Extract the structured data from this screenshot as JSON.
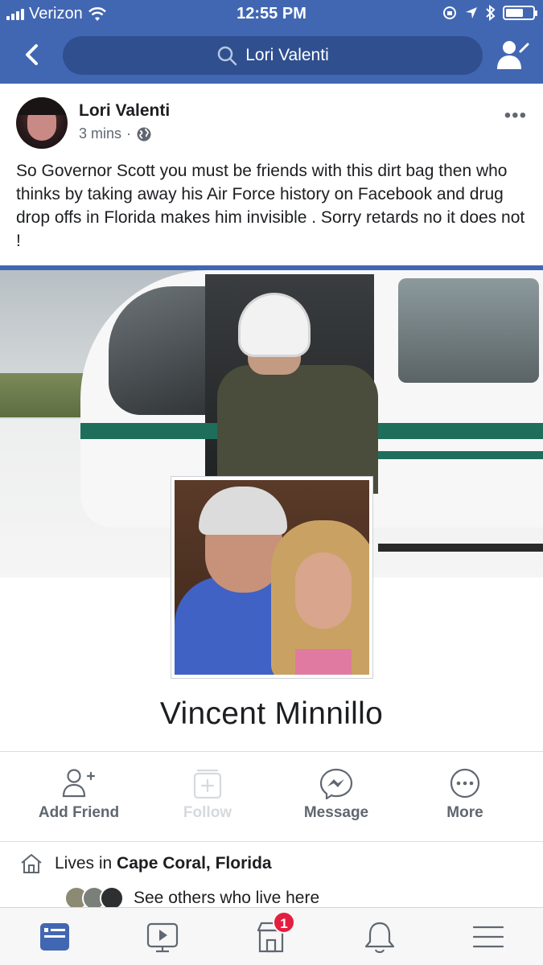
{
  "status_bar": {
    "carrier": "Verizon",
    "time": "12:55 PM",
    "battery_level": 0.7
  },
  "navbar": {
    "search_text": "Lori Valenti"
  },
  "post": {
    "author": "Lori Valenti",
    "timestamp": "3 mins",
    "separator": "·",
    "text": "So Governor Scott you must be friends with this dirt bag then who thinks by taking away his Air Force history on Facebook and drug drop offs in Florida makes him invisible . Sorry retards no it does not !"
  },
  "shared_profile": {
    "name": "Vincent Minnillo",
    "actions": [
      {
        "label": "Add Friend",
        "icon": "add-friend-icon",
        "enabled": true
      },
      {
        "label": "Follow",
        "icon": "follow-icon",
        "enabled": false
      },
      {
        "label": "Message",
        "icon": "messenger-icon",
        "enabled": true
      },
      {
        "label": "More",
        "icon": "more-icon",
        "enabled": true
      }
    ],
    "lives_prefix": "Lives in",
    "lives_place": "Cape Coral, Florida",
    "others_text": "See others who live here"
  },
  "tabbar": {
    "tabs": [
      {
        "name": "news-feed",
        "active": true
      },
      {
        "name": "watch",
        "active": false
      },
      {
        "name": "marketplace",
        "active": false,
        "badge": "1"
      },
      {
        "name": "notifications",
        "active": false
      },
      {
        "name": "menu",
        "active": false
      }
    ]
  },
  "colors": {
    "brand_blue": "#4267b2",
    "search_bg": "#2f4f8f",
    "badge_red": "#e41e3f",
    "active_tab": "#4267b2"
  }
}
